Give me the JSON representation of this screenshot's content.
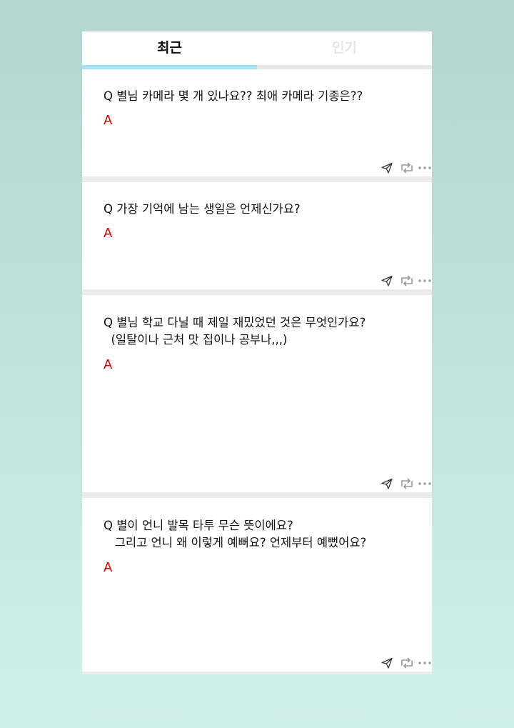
{
  "tabs": {
    "recent": "최근",
    "popular": "인기"
  },
  "posts": [
    {
      "question": "Q 별님 카메라 몇 개 있나요?? 최애 카메라 기종은??",
      "answer": "A"
    },
    {
      "question": "Q 가장 기억에 남는 생일은 언제신가요?",
      "answer": "A"
    },
    {
      "question": "Q 별님 학교 다닐 때 제일 재밌었던 것은 무엇인가요?\n  (일탈이나 근처 맛 집이나 공부나,,,)",
      "answer": "A"
    },
    {
      "question": "Q 별이 언니 발목 타투 무슨 뜻이에요?\n   그리고 언니 왜 이렇게 예뻐요? 언제부터 예뻤어요?",
      "answer": "A"
    }
  ],
  "icons": {
    "send": "paper-plane-icon",
    "repost": "repost-icon",
    "more": "more-dots-icon"
  },
  "colors": {
    "tab_active": "#111111",
    "tab_inactive": "#e6e6e6",
    "tab_indicator": "#a5e4f5",
    "answer_red": "#e00000",
    "icon_gray": "#9a9a9a"
  }
}
